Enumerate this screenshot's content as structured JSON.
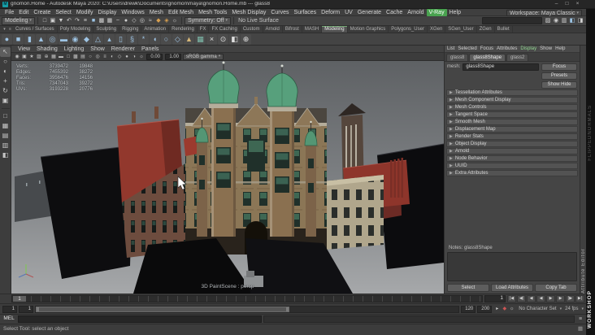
{
  "window": {
    "title": "gnomon.Home - Autodesk Maya 2020: C:\\Users\\drewk\\Documents\\gnomon\\maya\\gnomon.Home.mb --- glass8",
    "logo_letter": "M",
    "buttons": {
      "minimize": "–",
      "ma2ximize": "□",
      "maximize": "□",
      "close": "×"
    }
  },
  "menu_bar": {
    "items": [
      {
        "label": "File"
      },
      {
        "label": "Edit"
      },
      {
        "label": "Create"
      },
      {
        "label": "Select"
      },
      {
        "label": "Modify"
      },
      {
        "label": "Display"
      },
      {
        "label": "Windows"
      },
      {
        "label": "Mesh"
      },
      {
        "label": "Edit Mesh"
      },
      {
        "label": "Mesh Tools"
      },
      {
        "label": "Mesh Display"
      },
      {
        "label": "Curves"
      },
      {
        "label": "Surfaces"
      },
      {
        "label": "Deform"
      },
      {
        "label": "UV"
      },
      {
        "label": "Generate"
      },
      {
        "label": "Cache"
      },
      {
        "label": "Arnold"
      },
      {
        "label": "V-Ray",
        "active": true
      },
      {
        "label": "Help"
      }
    ],
    "workspace_label": "Workspace:",
    "workspace_value": "Maya Classic",
    "caret": "▾"
  },
  "status_line": {
    "mode": "Modeling",
    "caret": "▾",
    "icons_left": [
      {
        "name": "new-scene-icon",
        "glyph": "□",
        "color": "#d2d2d2"
      },
      {
        "name": "open-scene-icon",
        "glyph": "▣",
        "color": "#d2d2d2"
      },
      {
        "name": "save-scene-icon",
        "glyph": "▼",
        "color": "#d2d2d2"
      },
      {
        "name": "undo-icon",
        "glyph": "↶",
        "color": "#d2d2d2"
      },
      {
        "name": "redo-icon",
        "glyph": "↷",
        "color": "#d2d2d2"
      },
      {
        "name": "select-by-hierarchy-icon",
        "glyph": "≡",
        "color": "#d2d2d2"
      },
      {
        "name": "select-by-object-icon",
        "glyph": "■",
        "color": "#9ec7e8"
      },
      {
        "name": "select-by-component-icon",
        "glyph": "▩",
        "color": "#d2d2d2"
      },
      {
        "name": "snap-to-grid-icon",
        "glyph": "▦",
        "color": "#d2d2d2"
      },
      {
        "name": "snap-to-curve-icon",
        "glyph": "~",
        "color": "#d2d2d2"
      },
      {
        "name": "snap-to-point-icon",
        "glyph": "●",
        "color": "#d2d2d2"
      },
      {
        "name": "snap-to-plane-icon",
        "glyph": "◇",
        "color": "#d2d2d2"
      },
      {
        "name": "make-live-icon",
        "glyph": "◎",
        "color": "#d2d2d2"
      },
      {
        "name": "construction-history-icon",
        "glyph": "≈",
        "color": "#d2d2d2"
      },
      {
        "name": "render-current-frame-icon",
        "glyph": "◆",
        "color": "#d8a050"
      },
      {
        "name": "ipr-render-icon",
        "glyph": "◈",
        "color": "#d8a050"
      },
      {
        "name": "render-settings-icon",
        "glyph": "☼",
        "color": "#d2d2d2"
      }
    ],
    "symmetry_label": "Symmetry: Off",
    "live_surface_label": "No Live Surface",
    "icons_right": [
      {
        "name": "modeling-toolkit-toggle-icon",
        "glyph": "▨",
        "color": "#d2d2d2"
      },
      {
        "name": "hypershade-toggle-icon",
        "glyph": "◉",
        "color": "#d2d2d2"
      },
      {
        "name": "channel-box-toggle-icon",
        "glyph": "▥",
        "color": "#d2d2d2"
      },
      {
        "name": "attribute-editor-toggle-icon",
        "glyph": "◧",
        "color": "#9ec7e8"
      },
      {
        "name": "tool-settings-toggle-icon",
        "glyph": "◨",
        "color": "#d2d2d2"
      }
    ]
  },
  "shelf": {
    "menu_icons": {
      "list": "▾",
      "gear": "≡"
    },
    "tabs": [
      {
        "label": "Curves / Surfaces"
      },
      {
        "label": "Poly Modeling"
      },
      {
        "label": "Sculpting"
      },
      {
        "label": "Rigging"
      },
      {
        "label": "Animation"
      },
      {
        "label": "Rendering"
      },
      {
        "label": "FX"
      },
      {
        "label": "FX Caching"
      },
      {
        "label": "Custom"
      },
      {
        "label": "Arnold"
      },
      {
        "label": "Bifrost"
      },
      {
        "label": "MASH"
      },
      {
        "label": "Modeling",
        "active": true
      },
      {
        "label": "Motion Graphics"
      },
      {
        "label": "Polygons_User"
      },
      {
        "label": "XGen"
      },
      {
        "label": "SGen_User"
      },
      {
        "label": "ZGen"
      },
      {
        "label": "Bullet"
      }
    ],
    "icons": [
      {
        "name": "shelf-poly-sphere-icon",
        "glyph": "●",
        "color": "#9ec4e4"
      },
      {
        "name": "shelf-poly-cube-icon",
        "glyph": "■",
        "color": "#9ec4e4"
      },
      {
        "name": "shelf-poly-cylinder-icon",
        "glyph": "▮",
        "color": "#9ec4e4"
      },
      {
        "name": "shelf-poly-cone-icon",
        "glyph": "▲",
        "color": "#9ec4e4"
      },
      {
        "name": "shelf-poly-torus-icon",
        "glyph": "◎",
        "color": "#9ec4e4"
      },
      {
        "name": "shelf-poly-plane-icon",
        "glyph": "▬",
        "color": "#9ec4e4"
      },
      {
        "name": "shelf-poly-disc-icon",
        "glyph": "◉",
        "color": "#9ec4e4"
      },
      {
        "name": "shelf-platonic-solid-icon",
        "glyph": "◆",
        "color": "#9ec4e4"
      },
      {
        "name": "shelf-poly-pyramid-icon",
        "glyph": "△",
        "color": "#9ec4e4"
      },
      {
        "name": "shelf-poly-prism-icon",
        "glyph": "▴",
        "color": "#9ec4e4"
      },
      {
        "name": "shelf-poly-pipe-icon",
        "glyph": "▯",
        "color": "#9ec4e4"
      },
      {
        "name": "shelf-poly-helix-icon",
        "glyph": "§",
        "color": "#9ec4e4"
      },
      {
        "name": "shelf-poly-gear-icon",
        "glyph": "*",
        "color": "#9ec4e4"
      },
      {
        "name": "shelf-soccer-ball-icon",
        "glyph": "◖",
        "color": "#9ec4e4"
      },
      {
        "name": "shelf-super-ellipse-icon",
        "glyph": "○",
        "color": "#9ec4e4"
      },
      {
        "name": "shelf-ultra-shape-icon",
        "glyph": "◇",
        "color": "#9ec4e4"
      },
      {
        "name": "shelf-sculpt-tool-icon",
        "glyph": "▲",
        "color": "#d8b878"
      },
      {
        "name": "shelf-quad-draw-icon",
        "glyph": "▦",
        "color": "#7fbfae"
      },
      {
        "name": "shelf-multi-cut-icon",
        "glyph": "×",
        "color": "#e0e0e0"
      },
      {
        "name": "shelf-target-weld-icon",
        "glyph": "⊙",
        "color": "#e0e0e0"
      },
      {
        "name": "shelf-bevel-icon",
        "glyph": "◧",
        "color": "#e0e0e0"
      },
      {
        "name": "shelf-extrude-icon",
        "glyph": "⊕",
        "color": "#e0e0e0"
      }
    ]
  },
  "toolbox": {
    "tools": [
      {
        "name": "select-tool-icon",
        "glyph": "↖",
        "active": true
      },
      {
        "name": "lasso-tool-icon",
        "glyph": "○"
      },
      {
        "name": "paint-select-tool-icon",
        "glyph": "◐"
      },
      {
        "name": "move-tool-icon",
        "glyph": "+"
      },
      {
        "name": "rotate-tool-icon",
        "glyph": "↻"
      },
      {
        "name": "scale-tool-icon",
        "glyph": "▣"
      }
    ],
    "layouts": [
      {
        "name": "single-pane-layout-icon",
        "glyph": "□"
      },
      {
        "name": "four-pane-layout-icon",
        "glyph": "▦"
      },
      {
        "name": "two-pane-stacked-layout-icon",
        "glyph": "▤"
      },
      {
        "name": "two-pane-side-layout-icon",
        "glyph": "▥"
      },
      {
        "name": "outliner-persp-layout-icon",
        "glyph": "◧"
      }
    ]
  },
  "viewport": {
    "menus": [
      {
        "label": "View"
      },
      {
        "label": "Shading"
      },
      {
        "label": "Lighting"
      },
      {
        "label": "Show"
      },
      {
        "label": "Renderer"
      },
      {
        "label": "Panels"
      }
    ],
    "toolbar_icons": [
      {
        "name": "lock-camera-icon",
        "glyph": "◉"
      },
      {
        "name": "camera-attributes-icon",
        "glyph": "▣"
      },
      {
        "name": "bookmarks-icon",
        "glyph": "★"
      },
      {
        "name": "image-plane-icon",
        "glyph": "▨"
      },
      {
        "name": "two-d-pan-zoom-icon",
        "glyph": "⊕"
      },
      {
        "name": "grid-toggle-icon",
        "glyph": "▦"
      },
      {
        "name": "film-gate-icon",
        "glyph": "▬"
      },
      {
        "name": "resolution-gate-icon",
        "glyph": "□"
      },
      {
        "name": "gate-mask-icon",
        "glyph": "▩"
      },
      {
        "name": "field-chart-icon",
        "glyph": "▤"
      },
      {
        "name": "safe-action-icon",
        "glyph": "○"
      },
      {
        "name": "safe-title-icon",
        "glyph": "◎"
      },
      {
        "name": "hud-toggle-icon",
        "glyph": "≡"
      },
      {
        "name": "xray-icon",
        "glyph": "◐"
      },
      {
        "name": "wireframe-icon",
        "glyph": "◇"
      },
      {
        "name": "shaded-icon",
        "glyph": "●"
      },
      {
        "name": "textured-icon",
        "glyph": "◑"
      },
      {
        "name": "lights-icon",
        "glyph": "☼"
      }
    ],
    "exposure": "0.00",
    "gamma": "1.00",
    "view_transform": "sRGB gamma",
    "hud_rows": [
      {
        "label": "Verts:",
        "total": "3739472",
        "selected": "19848"
      },
      {
        "label": "Edges:",
        "total": "7455392",
        "selected": "38272"
      },
      {
        "label": "Faces:",
        "total": "3956476",
        "selected": "14156"
      },
      {
        "label": "Tris:",
        "total": "7347043",
        "selected": "39272"
      },
      {
        "label": "UVs:",
        "total": "3193228",
        "selected": "20776"
      }
    ],
    "camera_label": "3D PaintScene : persp"
  },
  "attribute_editor": {
    "menus": [
      {
        "label": "List"
      },
      {
        "label": "Selected"
      },
      {
        "label": "Focus"
      },
      {
        "label": "Attributes"
      },
      {
        "label": "Display",
        "active": true
      },
      {
        "label": "Show"
      },
      {
        "label": "Help"
      }
    ],
    "tabs": [
      {
        "label": "glass8"
      },
      {
        "label": "glass8Shape",
        "active": true
      },
      {
        "label": "glass2"
      }
    ],
    "node_type_label": "mesh:",
    "node_name": "glass8Shape",
    "focus_button": "Focus",
    "presets_button": "Presets",
    "show_hide_button": "Show Hide",
    "sections": [
      {
        "label": "Tessellation Attributes"
      },
      {
        "label": "Mesh Component Display"
      },
      {
        "label": "Mesh Controls"
      },
      {
        "label": "Tangent Space"
      },
      {
        "label": "Smooth Mesh"
      },
      {
        "label": "Displacement Map"
      },
      {
        "label": "Render Stats"
      },
      {
        "label": "Object Display"
      },
      {
        "label": "Arnold"
      },
      {
        "label": "Node Behavior"
      },
      {
        "label": "UUID"
      },
      {
        "label": "Extra Attributes"
      }
    ],
    "notes_label": "Notes: glass8Shape",
    "footer_buttons": [
      {
        "label": "Select"
      },
      {
        "label": "Load Attributes"
      },
      {
        "label": "Copy Tab"
      }
    ]
  },
  "right_edge": {
    "panel_tab": "Attribute Editor",
    "watermark_top": "FLIPPEDNORMALS",
    "watermark_bottom": "WORKSHOP"
  },
  "timeline": {
    "current_frame": "1",
    "playback_buttons": [
      {
        "name": "go-to-start-button",
        "glyph": "|◀"
      },
      {
        "name": "step-back-frame-button",
        "glyph": "◀|"
      },
      {
        "name": "step-back-key-button",
        "glyph": "◀"
      },
      {
        "name": "play-backwards-button",
        "glyph": "◀"
      },
      {
        "name": "play-forwards-button",
        "glyph": "▶"
      },
      {
        "name": "step-forward-key-button",
        "glyph": "▶"
      },
      {
        "name": "step-forward-frame-button",
        "glyph": "|▶"
      },
      {
        "name": "go-to-end-button",
        "glyph": "▶|"
      }
    ]
  },
  "range_slider": {
    "anim_start": "1",
    "playback_start": "1",
    "playback_end": "120",
    "anim_end": "200",
    "character_set": "No Character Set",
    "fps": "24 fps",
    "caret": "▾",
    "icons": [
      {
        "name": "playback-speed-icon",
        "glyph": "▸",
        "color": "#cccccc"
      },
      {
        "name": "auto-keyframe-icon",
        "glyph": "◆",
        "color": "#cc5555"
      },
      {
        "name": "animation-preferences-icon",
        "glyph": "☼",
        "color": "#cccccc"
      }
    ]
  },
  "command_line": {
    "label": "MEL",
    "history_icon": "≡"
  },
  "help_line": {
    "text": "Select Tool: select an object",
    "grid_icon": "▦"
  }
}
